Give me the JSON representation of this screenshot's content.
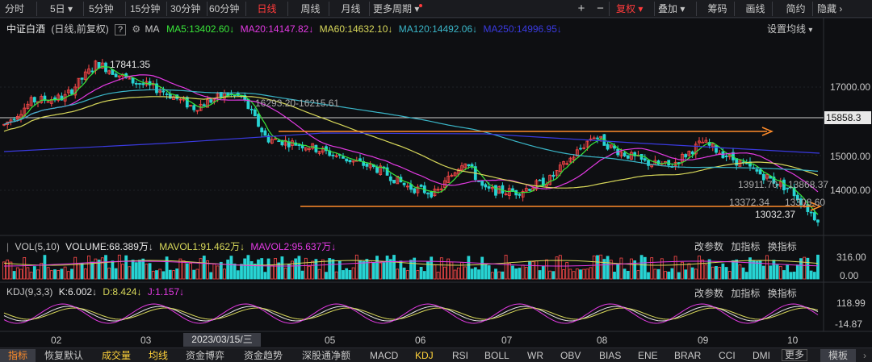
{
  "toolbar": {
    "periods": [
      "分时",
      "5日",
      "5分钟",
      "15分钟",
      "30分钟",
      "60分钟",
      "日线",
      "周线",
      "月线",
      "更多周期"
    ],
    "active_period": "日线",
    "right_buttons": [
      "+",
      "−",
      "复权",
      "叠加",
      "筹码",
      "画线",
      "简约",
      "隐藏"
    ],
    "restore_label": "复权"
  },
  "main": {
    "title": "中证白酒",
    "subtitle": "(日线,前复权)",
    "help": "?",
    "ma_label": "MA",
    "ma5": "MA5:13402.60",
    "ma20": "MA20:14147.82",
    "ma60": "MA60:14632.10",
    "ma120": "MA120:14492.06",
    "ma250": "MA250:14996.95",
    "settings": "设置均线",
    "annotations": {
      "high": "17841.35",
      "range1": "16293.20-16215.61",
      "a1": "13911.70",
      "a2": "13868.37",
      "a3": "13372.34",
      "a4": "13308.60",
      "low": "13032.37"
    },
    "y_ticks": [
      "17000.00",
      "15000.00",
      "14000.00"
    ],
    "price_tag": "15858.3"
  },
  "volume": {
    "label": "VOL(5,10)",
    "volume": "VOLUME:68.389万",
    "mavol1": "MAVOL1:91.462万",
    "mavol2": "MAVOL2:95.637万",
    "actions": [
      "改参数",
      "加指标",
      "换指标"
    ],
    "y_ticks": [
      "316.00",
      "0.00"
    ]
  },
  "kdj": {
    "label": "KDJ(9,3,3)",
    "k": "K:6.002",
    "d": "D:8.424",
    "j": "J:1.157",
    "actions": [
      "改参数",
      "加指标",
      "换指标"
    ],
    "y_ticks": [
      "118.99",
      "-14.87"
    ]
  },
  "x_axis": {
    "labels": [
      "02",
      "03",
      "05",
      "06",
      "07",
      "08",
      "09",
      "10"
    ],
    "cursor_date": "2023/03/15/三"
  },
  "bottom": {
    "tabs": [
      "指标",
      "恢复默认",
      "成交量",
      "均线",
      "资金博弈",
      "资金趋势",
      "深股通净额",
      "MACD",
      "KDJ",
      "RSI",
      "BOLL",
      "WR",
      "OBV",
      "BIAS",
      "ENE",
      "BRAR",
      "CCI",
      "DMI",
      "更多"
    ],
    "template": "模板"
  },
  "colors": {
    "up": "#ff4a4a",
    "down": "#27d3d3",
    "ma5": "#39e639",
    "ma20": "#e33ae3",
    "ma60": "#d8d85a",
    "ma120": "#3ab6c8",
    "ma250": "#3a3ae0",
    "orange": "#ff8c2a"
  }
}
